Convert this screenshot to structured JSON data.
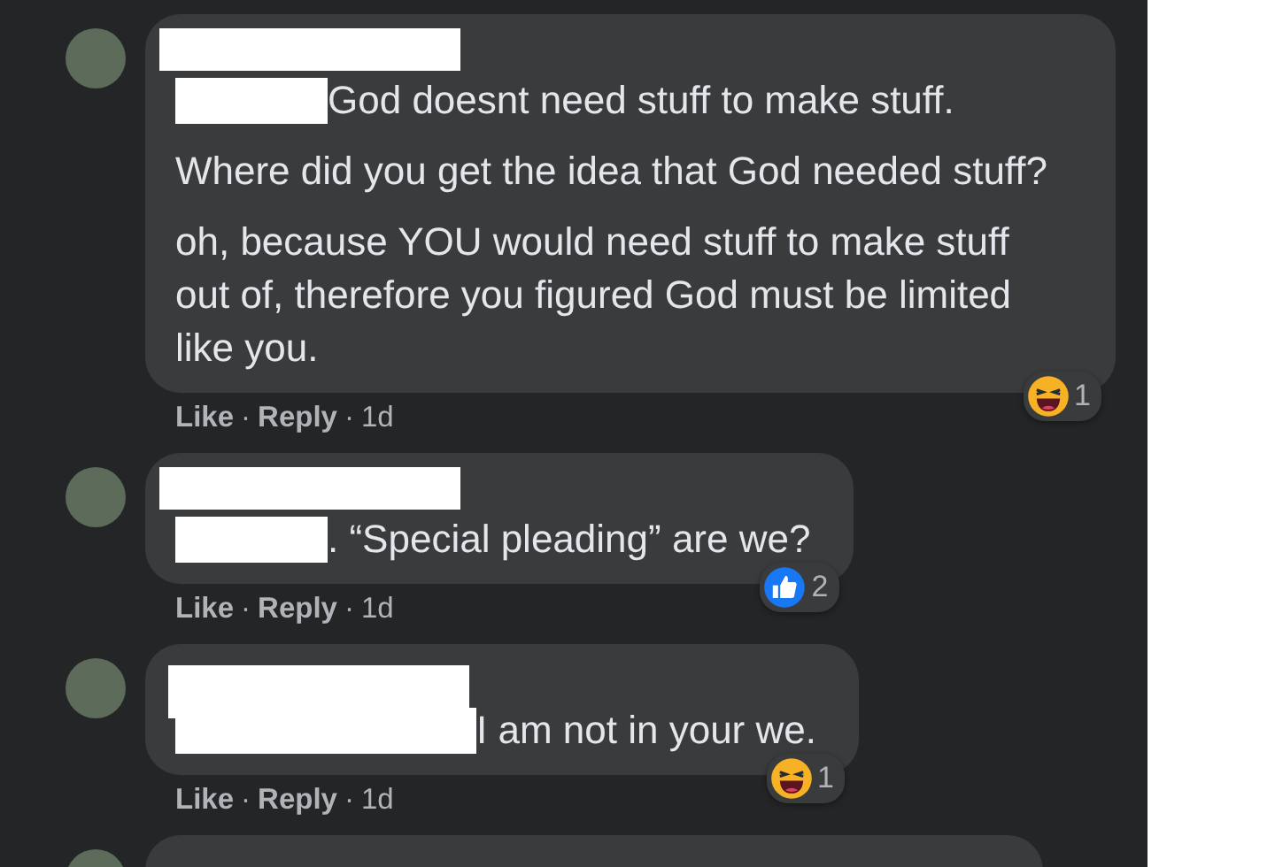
{
  "comments": [
    {
      "paragraphs": [
        "God doesnt need stuff to make stuff.",
        "Where did you get the idea that God needed stuff?",
        "oh, because YOU would need stuff to make stuff out of, therefore you figured God must be limited like you."
      ],
      "reaction": {
        "kind": "haha",
        "count": "1"
      },
      "actions": {
        "like": "Like",
        "sep1": "·",
        "reply": "Reply",
        "sep2": "·",
        "time": "1d"
      }
    },
    {
      "paragraphs": [
        ". “Special pleading” are we?"
      ],
      "reaction": {
        "kind": "like",
        "count": "2"
      },
      "actions": {
        "like": "Like",
        "sep1": "·",
        "reply": "Reply",
        "sep2": "·",
        "time": "1d"
      }
    },
    {
      "paragraphs": [
        "I am not in your we."
      ],
      "reaction": {
        "kind": "haha",
        "count": "1"
      },
      "actions": {
        "like": "Like",
        "sep1": "·",
        "reply": "Reply",
        "sep2": "·",
        "time": "1d"
      }
    }
  ]
}
